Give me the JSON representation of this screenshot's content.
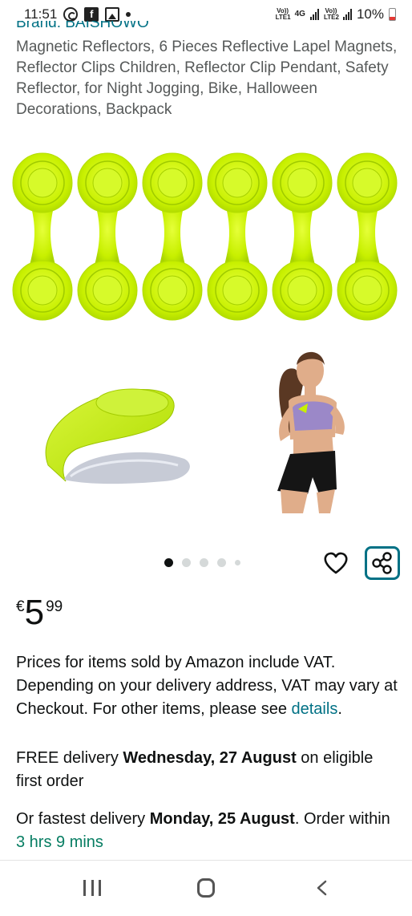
{
  "status_bar": {
    "time": "11:51",
    "left_icons": [
      "whatsapp-icon",
      "facebook-icon",
      "gallery-icon",
      "dot-icon"
    ],
    "sim1_label": "Vo)) LTE1",
    "sim1_net": "4G",
    "sim2_label": "Vo)) LTE2",
    "battery_text": "10%",
    "battery_level": 0.1
  },
  "product": {
    "brand": "Brand: BAISHOWO",
    "title": "Magnetic Reflectors, 6 Pieces Reflective Lapel Magnets, Reflector Clips Children, Reflector Clip Pendant, Safety Reflector, for Night Jogging, Bike, Halloween Decorations, Backpack",
    "image_count": 5,
    "active_image": 1
  },
  "price": {
    "currency": "€",
    "whole": "5",
    "fraction": "99"
  },
  "vat_notice": {
    "text": "Prices for items sold by Amazon include VAT. Depending on your delivery address, VAT may vary at Checkout. For other items, please see ",
    "link": "details",
    "end": "."
  },
  "delivery": {
    "free_prefix": "FREE delivery ",
    "free_date": "Wednesday, 27 August",
    "free_suffix": " on eligible first order",
    "fast_prefix": "Or fastest delivery ",
    "fast_date": "Monday, 25 August",
    "fast_mid": ". Order within ",
    "countdown": "3 hrs 9 mins"
  },
  "colors": {
    "link": "#007185",
    "countdown": "#067d62",
    "reflector": "#c8f000"
  },
  "nav": {
    "icons": [
      "recent-apps-icon",
      "home-icon",
      "back-icon"
    ]
  }
}
